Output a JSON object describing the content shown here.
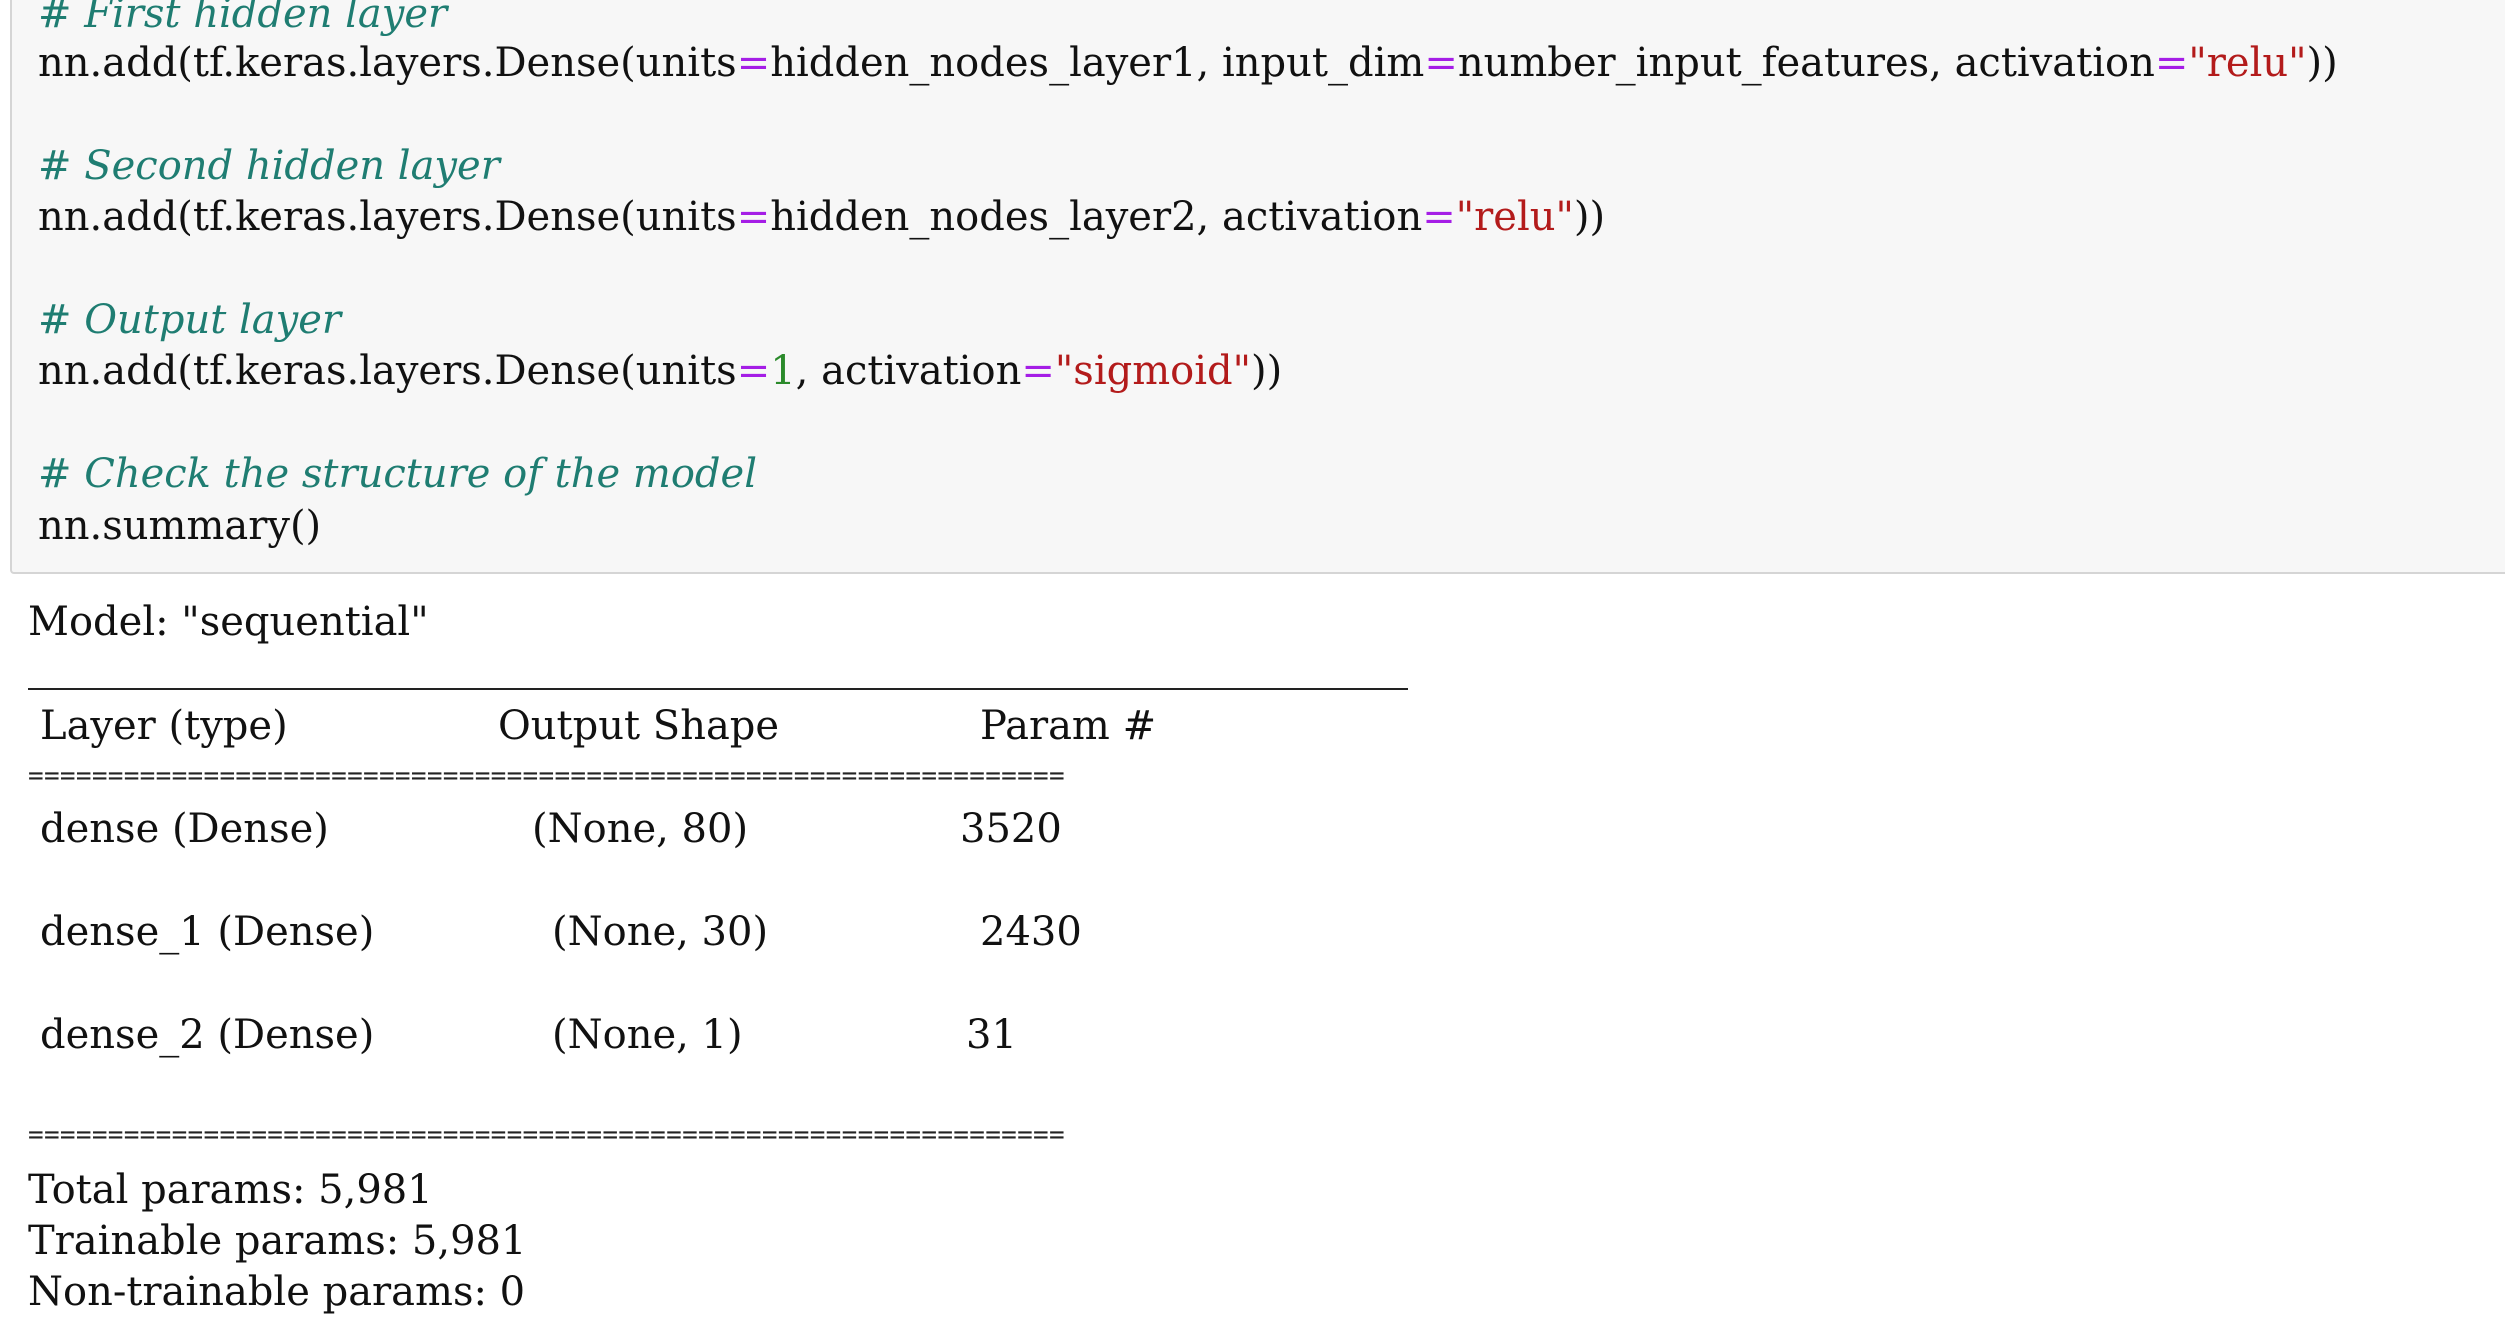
{
  "code": {
    "comment_first": "# First hidden layer",
    "line1": {
      "a": "nn.add(tf.keras.layers.Dense(units",
      "eq1": "=",
      "b": "hidden_nodes_layer1, input_dim",
      "eq2": "=",
      "c": "number_input_features, activation",
      "eq3": "=",
      "s": "\"relu\"",
      "end": "))"
    },
    "comment_second": "# Second hidden layer",
    "line2": {
      "a": "nn.add(tf.keras.layers.Dense(units",
      "eq1": "=",
      "b": "hidden_nodes_layer2, activation",
      "eq2": "=",
      "s": "\"relu\"",
      "end": "))"
    },
    "comment_output": "# Output layer",
    "line3": {
      "a": "nn.add(tf.keras.layers.Dense(units",
      "eq1": "=",
      "n": "1",
      "b": ", activation",
      "eq2": "=",
      "s": "\"sigmoid\"",
      "end": "))"
    },
    "comment_check": "# Check the structure of the model",
    "line4": "nn.summary()"
  },
  "output": {
    "model_line": "Model: \"sequential\"",
    "headers": {
      "layer": "Layer (type)",
      "shape": "Output Shape",
      "params": "Param #"
    },
    "separator": "=================================================================",
    "rows": [
      {
        "layer": "dense (Dense)",
        "shape": "(None, 80)",
        "params": "3520"
      },
      {
        "layer": "dense_1 (Dense)",
        "shape": "(None, 30)",
        "params": "2430"
      },
      {
        "layer": "dense_2 (Dense)",
        "shape": "(None, 1)",
        "params": "31"
      }
    ],
    "total": "Total params: 5,981",
    "trainable": "Trainable params: 5,981",
    "non_trainable": "Non-trainable params: 0"
  },
  "colors": {
    "comment": "#1f7d72",
    "operator": "#a51ee6",
    "string": "#b31b1b",
    "number": "#2b8a2b",
    "cell_background": "#f7f7f7"
  }
}
